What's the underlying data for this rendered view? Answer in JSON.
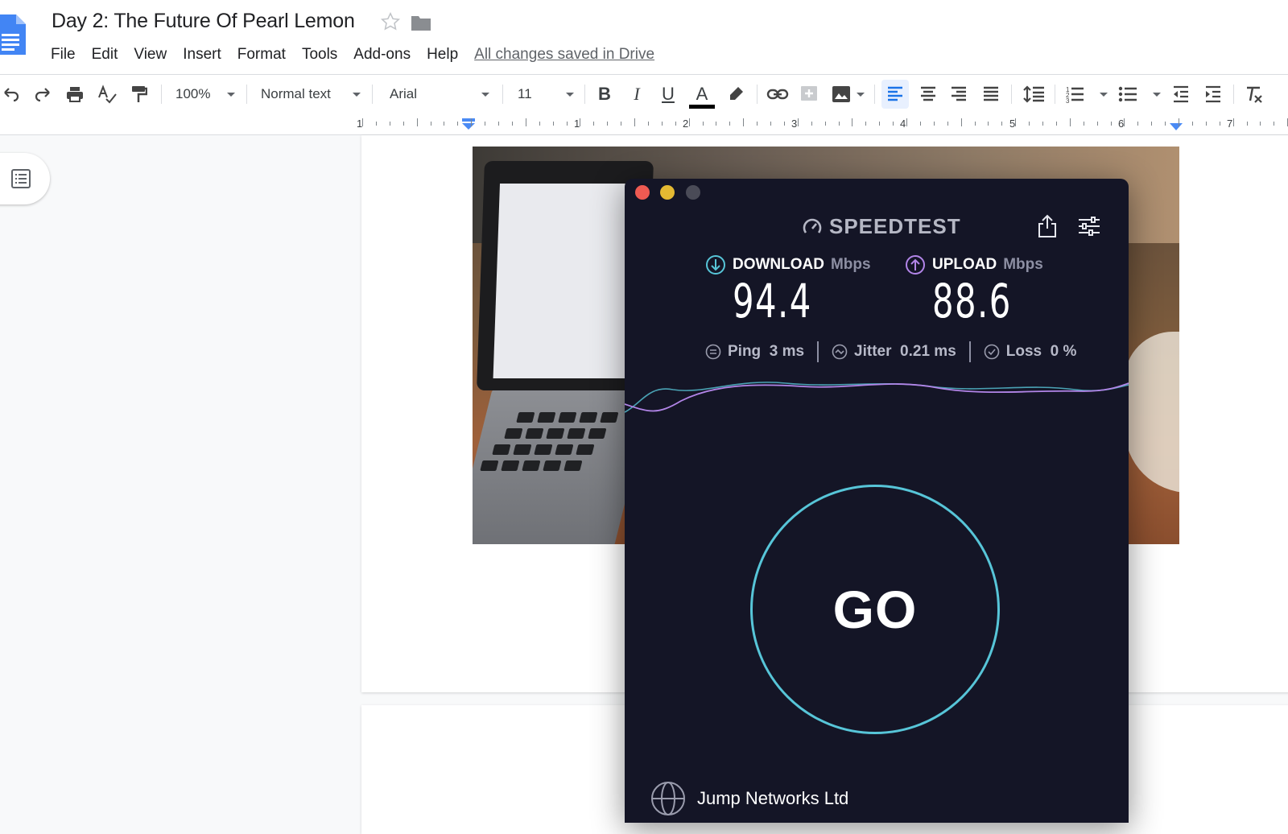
{
  "docs": {
    "title": "Day 2: The Future Of Pearl Lemon",
    "menu": [
      "File",
      "Edit",
      "View",
      "Insert",
      "Format",
      "Tools",
      "Add-ons",
      "Help"
    ],
    "save_status": "All changes saved in Drive"
  },
  "toolbar": {
    "zoom": "100%",
    "style": "Normal text",
    "font": "Arial",
    "font_size": "11",
    "bold": "B",
    "italic": "I",
    "underline": "U",
    "text_color": "A",
    "text_color_bar": "#000000"
  },
  "ruler": {
    "numbers": [
      "1",
      "1",
      "2",
      "3",
      "4",
      "5",
      "6",
      "7"
    ]
  },
  "speedtest": {
    "brand": "SPEEDTEST",
    "download": {
      "label": "DOWNLOAD",
      "unit": "Mbps",
      "value": "94.4"
    },
    "upload": {
      "label": "UPLOAD",
      "unit": "Mbps",
      "value": "88.6"
    },
    "ping": "Ping  3 ms",
    "jitter": "Jitter  0.21 ms",
    "loss": "Loss  0 %",
    "go": "GO",
    "isp": "Jump Networks Ltd",
    "colors": {
      "background": "#141526",
      "download_accent": "#57c5d8",
      "upload_accent": "#b285e8",
      "ring": "#57c5d8",
      "close": "#ee5a52",
      "minimize": "#e4b932",
      "zoom": "#4a4b57"
    }
  }
}
